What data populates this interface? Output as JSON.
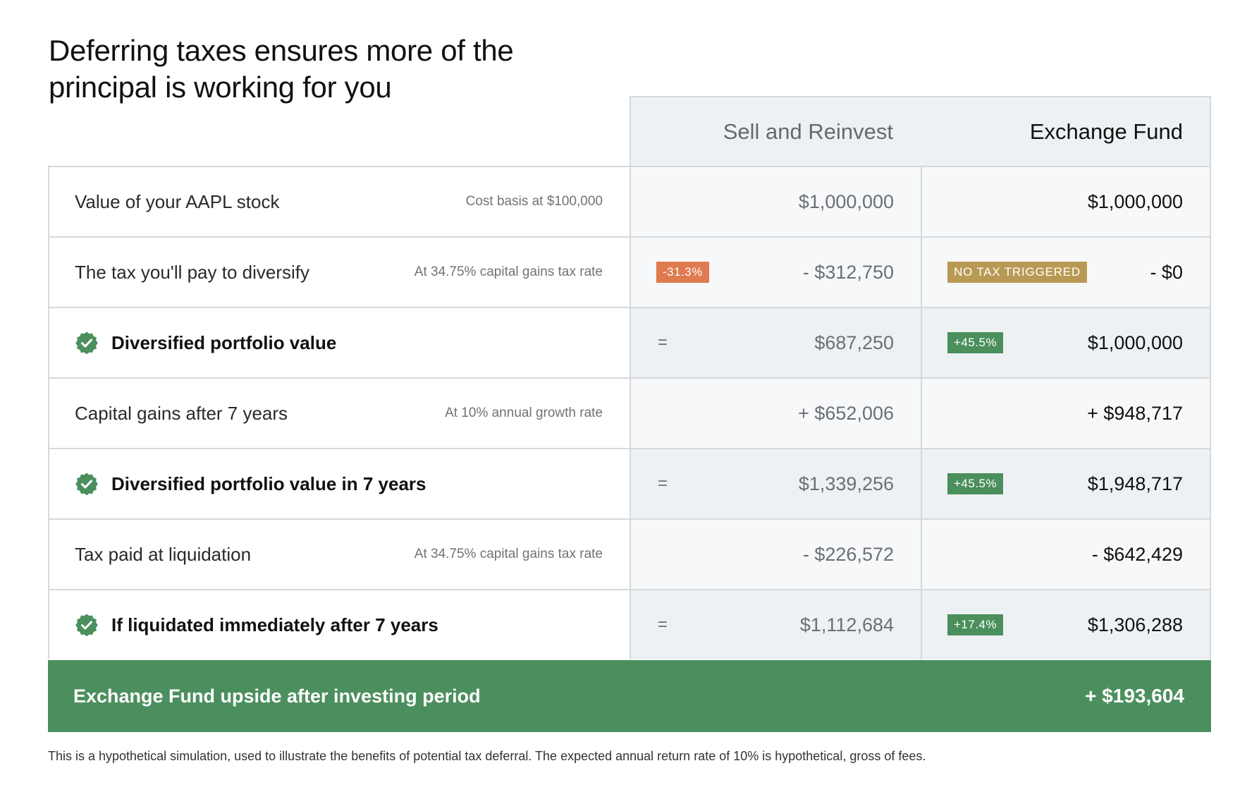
{
  "title": "Deferring taxes ensures more of the principal is working for you",
  "columns": {
    "sell": "Sell and Reinvest",
    "exchange": "Exchange Fund"
  },
  "rows": [
    {
      "label": "Value of your AAPL stock",
      "note": "Cost basis at $100,000",
      "sell": "$1,000,000",
      "exchange": "$1,000,000"
    },
    {
      "label": "The tax you'll pay to diversify",
      "note": "At 34.75% capital gains tax rate",
      "sell_badge": "-31.3%",
      "sell": "- $312,750",
      "exchange_badge": "NO TAX TRIGGERED",
      "exchange": "- $0"
    },
    {
      "label": "Diversified portfolio value",
      "sell_sign": "=",
      "sell": "$687,250",
      "exchange_badge": "+45.5%",
      "exchange": "$1,000,000"
    },
    {
      "label": "Capital gains after 7 years",
      "note": "At 10% annual growth rate",
      "sell": "+ $652,006",
      "exchange": "+ $948,717"
    },
    {
      "label": "Diversified portfolio value in 7 years",
      "sell_sign": "=",
      "sell": "$1,339,256",
      "exchange_badge": "+45.5%",
      "exchange": "$1,948,717"
    },
    {
      "label": "Tax paid at liquidation",
      "note": "At 34.75% capital gains tax rate",
      "sell": "- $226,572",
      "exchange": "- $642,429"
    },
    {
      "label": "If liquidated immediately after 7 years",
      "sell_sign": "=",
      "sell": "$1,112,684",
      "exchange_badge": "+17.4%",
      "exchange": "$1,306,288"
    }
  ],
  "total": {
    "label": "Exchange Fund upside after investing period",
    "value": "+ $193,604"
  },
  "footnote": "This is a hypothetical simulation, used to illustrate the benefits of potential tax deferral. The expected annual return rate of 10% is hypothetical, gross of fees.",
  "icons": {
    "highlight_row": "check-badge-icon"
  },
  "colors": {
    "accent_green": "#4c8f5e",
    "badge_red": "#e07a4f",
    "badge_gold": "#b99a55",
    "header_bg": "#eef1f4"
  },
  "chart_data": {
    "type": "table",
    "title": "Deferring taxes ensures more of the principal is working for you",
    "columns": [
      "Sell and Reinvest",
      "Exchange Fund"
    ],
    "rows": [
      {
        "label": "Value of your AAPL stock",
        "values": [
          1000000,
          1000000
        ]
      },
      {
        "label": "The tax you'll pay to diversify",
        "values": [
          -312750,
          0
        ]
      },
      {
        "label": "Diversified portfolio value",
        "values": [
          687250,
          1000000
        ]
      },
      {
        "label": "Capital gains after 7 years",
        "values": [
          652006,
          948717
        ]
      },
      {
        "label": "Diversified portfolio value in 7 years",
        "values": [
          1339256,
          1948717
        ]
      },
      {
        "label": "Tax paid at liquidation",
        "values": [
          -226572,
          -642429
        ]
      },
      {
        "label": "If liquidated immediately after 7 years",
        "values": [
          1112684,
          1306288
        ]
      }
    ]
  }
}
